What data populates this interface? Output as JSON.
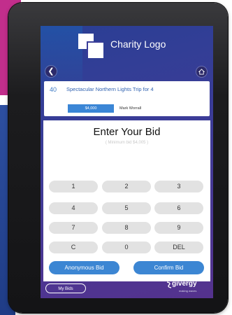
{
  "header": {
    "logo_text": "Charity Logo"
  },
  "item": {
    "number": "40",
    "title": "Spectacular Northern Lights Trip for 4",
    "current_bid": "$4,000",
    "bidder": "Mark Worrall"
  },
  "bid_panel": {
    "title": "Enter Your Bid",
    "minimum": "( Minimum bid $4,005 )"
  },
  "keypad": {
    "keys": [
      "1",
      "2",
      "3",
      "4",
      "5",
      "6",
      "7",
      "8",
      "9",
      "C",
      "0",
      "DEL"
    ]
  },
  "actions": {
    "anonymous": "Anonymous Bid",
    "confirm": "Confirm Bid"
  },
  "footer": {
    "my_bids": "My Bids",
    "brand": "givergy",
    "tagline": "making waves"
  },
  "colors": {
    "accent": "#3c86d3",
    "magenta": "#c22e8c",
    "screen_purple": "#3d3c98"
  },
  "icons": {
    "back": "chevron-left-icon",
    "home": "home-icon",
    "brand": "givergy-logo-icon"
  }
}
